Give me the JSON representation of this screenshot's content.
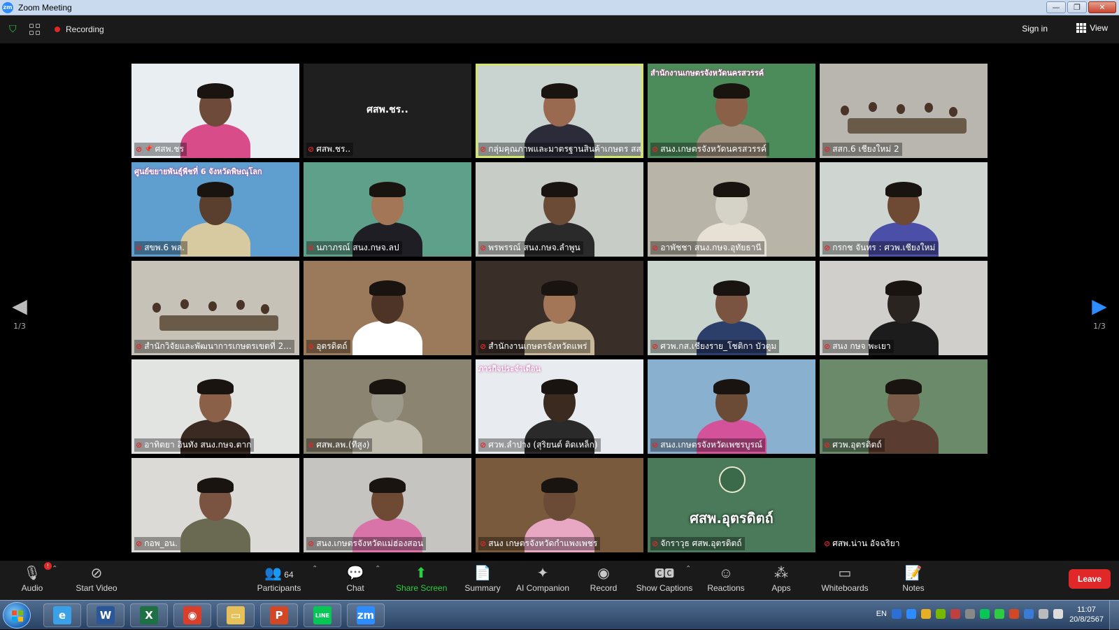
{
  "window": {
    "title": "Zoom Meeting",
    "app_icon": "zm",
    "controls": [
      "—",
      "❐",
      "✕"
    ]
  },
  "topbar": {
    "recording_label": "Recording",
    "sign_in": "Sign in",
    "view": "View"
  },
  "pagination": {
    "left": "1/3",
    "right": "1/3"
  },
  "tiles": [
    {
      "name": "ศสพ.ชร",
      "bg": "#e9eef2",
      "face": "#6e4a3a",
      "shirt": "#d94c8a",
      "pinned": true
    },
    {
      "name": "ศสพ.ชร..",
      "bg": "#1f1f1f",
      "center": "ศสพ.ชร.."
    },
    {
      "name": "กลุ่มคุณภาพและมาตรฐานสินค้าเกษตร สสจ.",
      "bg": "#c9d3cf",
      "face": "#9a6a50",
      "shirt": "#2b2b3a",
      "active": true
    },
    {
      "name": "สนง.เกษตรจังหวัดนครสวรรค์",
      "bg": "#4c8c5a",
      "face": "#8a6048",
      "shirt": "#9e8f7c",
      "banner": "สำนักงานเกษตรจังหวัดนครสวรรค์"
    },
    {
      "name": "สสก.6 เชียงใหม่ 2",
      "bg": "#b8b6ae",
      "room": true
    },
    {
      "name": "สขพ.6 พล.",
      "bg": "#5f9fd0",
      "face": "#5a3e2e",
      "shirt": "#d7c9a0",
      "banner": "ศูนย์ขยายพันธุ์พืชที่ 6 จังหวัดพิษณุโลก"
    },
    {
      "name": "นภาภรณ์ สนง.กษจ.ลป",
      "bg": "#5fa08a",
      "face": "#a47658",
      "shirt": "#1e1e24"
    },
    {
      "name": "พรพรรณ์ สนง.กษจ.ลำพูน",
      "bg": "#c8ccc6",
      "face": "#6b4a36",
      "shirt": "#2a2a2a"
    },
    {
      "name": "อาพัชชา สนง.กษจ.อุทัยธานี",
      "bg": "#b9b4a8",
      "face": "#d5d2c8",
      "shirt": "#e6e1d4"
    },
    {
      "name": "กรกช จันทร : ศวพ.เชียงใหม่",
      "bg": "#cfd6d2",
      "face": "#6e4a34",
      "shirt": "#4b4fa8"
    },
    {
      "name": "สำนักวิจัยและพัฒนาการเกษตรเขตที่ 2...",
      "bg": "#c6c2b8",
      "room": true
    },
    {
      "name": "อุตรดิตถ์",
      "bg": "#9a7a5a",
      "face": "#4e3426",
      "shirt": "#ffffff"
    },
    {
      "name": "สำนักงานเกษตรจังหวัดแพร่",
      "bg": "#3a2f28",
      "face": "#a47658",
      "shirt": "#c8b89a"
    },
    {
      "name": "ศวพ.กส.เชียงราย_โชติกา บัวตูม",
      "bg": "#c9d4cc",
      "face": "#7a5440",
      "shirt": "#2c3e6a"
    },
    {
      "name": "สนง กษจ พะเยา",
      "bg": "#d0cfcc",
      "face": "#2a2420",
      "shirt": "#1c1c1c"
    },
    {
      "name": "อาทิตยา อินทัง สนง.กษจ.ตาก",
      "bg": "#e2e4e2",
      "face": "#8a6048",
      "shirt": "#3a2a22"
    },
    {
      "name": "ศสพ.ลพ.(ทีสูง)",
      "bg": "#8a8470",
      "face": "#9d9a8c",
      "shirt": "#c0bcae"
    },
    {
      "name": "ศวพ.ลำปาง (สุริยนต์ ติดเหล็ก)",
      "bg": "#e8ebef",
      "face": "#3a2a20",
      "shirt": "#2a2a2a",
      "banner": "ภารกิจประจำเดือน"
    },
    {
      "name": "สนง.เกษตรจังหวัดเพชรบูรณ์",
      "bg": "#8ab0cf",
      "face": "#6b4a36",
      "shirt": "#d4529a"
    },
    {
      "name": "ศวพ.อุตรดิตถ์",
      "bg": "#6a8a6a",
      "face": "#7a5a48",
      "shirt": "#5a3c30"
    },
    {
      "name": "กอพ_อน.",
      "bg": "#dcdad6",
      "face": "#7a5440",
      "shirt": "#6a6a52"
    },
    {
      "name": "สนง.เกษตรจังหวัดแม่ฮ่องสอน",
      "bg": "#c6c4c0",
      "face": "#6e4a34",
      "shirt": "#d974a8"
    },
    {
      "name": "สนง เกษตรจังหวัดกำแพงเพชร",
      "bg": "#7a5a3c",
      "face": "#6b4a36",
      "shirt": "#e8a7c2"
    },
    {
      "name": "จักราวุธ ศสพ.อุตรดิตถ์",
      "bg": "#4a7a5a",
      "banner": "ศสพ.อุตรดิตถ์",
      "logo": true
    },
    {
      "name": "ศสพ.น่าน อัจฉริยา",
      "bg": "#000000"
    }
  ],
  "toolbar": {
    "audio": "Audio",
    "start_video": "Start Video",
    "participants": "Participants",
    "participants_count": "64",
    "chat": "Chat",
    "share_screen": "Share Screen",
    "summary": "Summary",
    "ai_companion": "AI Companion",
    "record": "Record",
    "show_captions": "Show Captions",
    "reactions": "Reactions",
    "apps": "Apps",
    "whiteboards": "Whiteboards",
    "notes": "Notes",
    "leave": "Leave",
    "audio_badge": "!"
  },
  "taskbar": {
    "apps": [
      {
        "name": "ie",
        "glyph": "e",
        "color": "#3aa0e8"
      },
      {
        "name": "word",
        "glyph": "W",
        "color": "#2b5797"
      },
      {
        "name": "excel",
        "glyph": "X",
        "color": "#1e7145"
      },
      {
        "name": "chrome",
        "glyph": "◉",
        "color": "#d9402c"
      },
      {
        "name": "explorer",
        "glyph": "▭",
        "color": "#e6c15a"
      },
      {
        "name": "powerpoint",
        "glyph": "P",
        "color": "#d24726"
      },
      {
        "name": "line",
        "glyph": "LINE",
        "color": "#06c755"
      },
      {
        "name": "zoom",
        "glyph": "zm",
        "color": "#2d8cff"
      }
    ],
    "language": "EN",
    "time": "11:07",
    "date": "20/8/2567"
  }
}
